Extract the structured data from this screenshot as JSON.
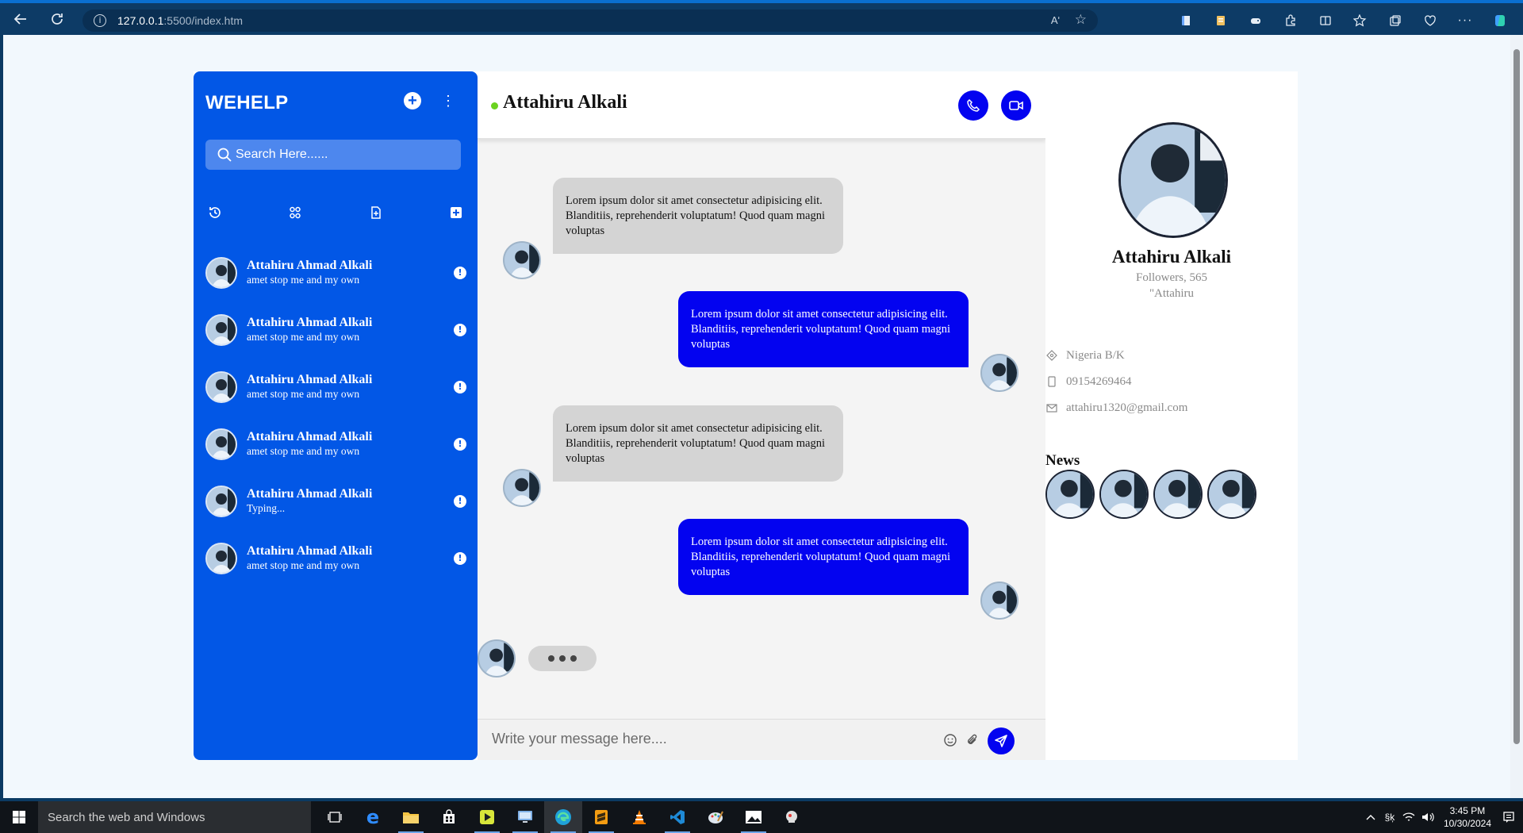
{
  "browser": {
    "url_host": "127.0.0.1",
    "url_path": ":5500/index.htm",
    "read_aloud_label": "Aʹ"
  },
  "sidebar": {
    "brand": "WEHELP",
    "search_placeholder": "Search Here......",
    "contacts": [
      {
        "name": "Attahiru Ahmad Alkali",
        "sub": "amet stop me and my own",
        "badge": "!"
      },
      {
        "name": "Attahiru Ahmad Alkali",
        "sub": "amet stop me and my own",
        "badge": "!"
      },
      {
        "name": "Attahiru Ahmad Alkali",
        "sub": "amet stop me and my own",
        "badge": "!"
      },
      {
        "name": "Attahiru Ahmad Alkali",
        "sub": "amet stop me and my own",
        "badge": "!"
      },
      {
        "name": "Attahiru Ahmad Alkali",
        "sub": "Typing...",
        "badge": "!"
      },
      {
        "name": "Attahiru Ahmad Alkali",
        "sub": "amet stop me and my own",
        "badge": "!"
      }
    ]
  },
  "chat": {
    "title": "Attahiru Alkali",
    "status_color": "#6bd21f",
    "messages": [
      {
        "direction": "in",
        "text": "Lorem ipsum dolor sit amet consectetur adipisicing elit. Blanditiis, reprehenderit voluptatum! Quod quam magni voluptas"
      },
      {
        "direction": "out",
        "text": "Lorem ipsum dolor sit amet consectetur adipisicing elit. Blanditiis, reprehenderit voluptatum! Quod quam magni voluptas"
      },
      {
        "direction": "in",
        "text": "Lorem ipsum dolor sit amet consectetur adipisicing elit. Blanditiis, reprehenderit voluptatum! Quod quam magni voluptas"
      },
      {
        "direction": "out",
        "text": "Lorem ipsum dolor sit amet consectetur adipisicing elit. Blanditiis, reprehenderit voluptatum! Quod quam magni voluptas"
      }
    ],
    "composer_placeholder": "Write your message here...."
  },
  "profile": {
    "name": "Attahiru Alkali",
    "followers": "Followers, 565",
    "handle": "\"Attahiru",
    "location": "Nigeria B/K",
    "phone": "09154269464",
    "email": "attahiru1320@gmail.com",
    "news_title": "News"
  },
  "taskbar": {
    "search_text": "Search the web and Windows",
    "time": "3:45 PM",
    "date": "10/30/2024",
    "lang": "§ķ"
  },
  "colors": {
    "sidebar": "#0257e6",
    "accent": "#0303f0",
    "incoming_bubble": "#d4d4d4"
  }
}
